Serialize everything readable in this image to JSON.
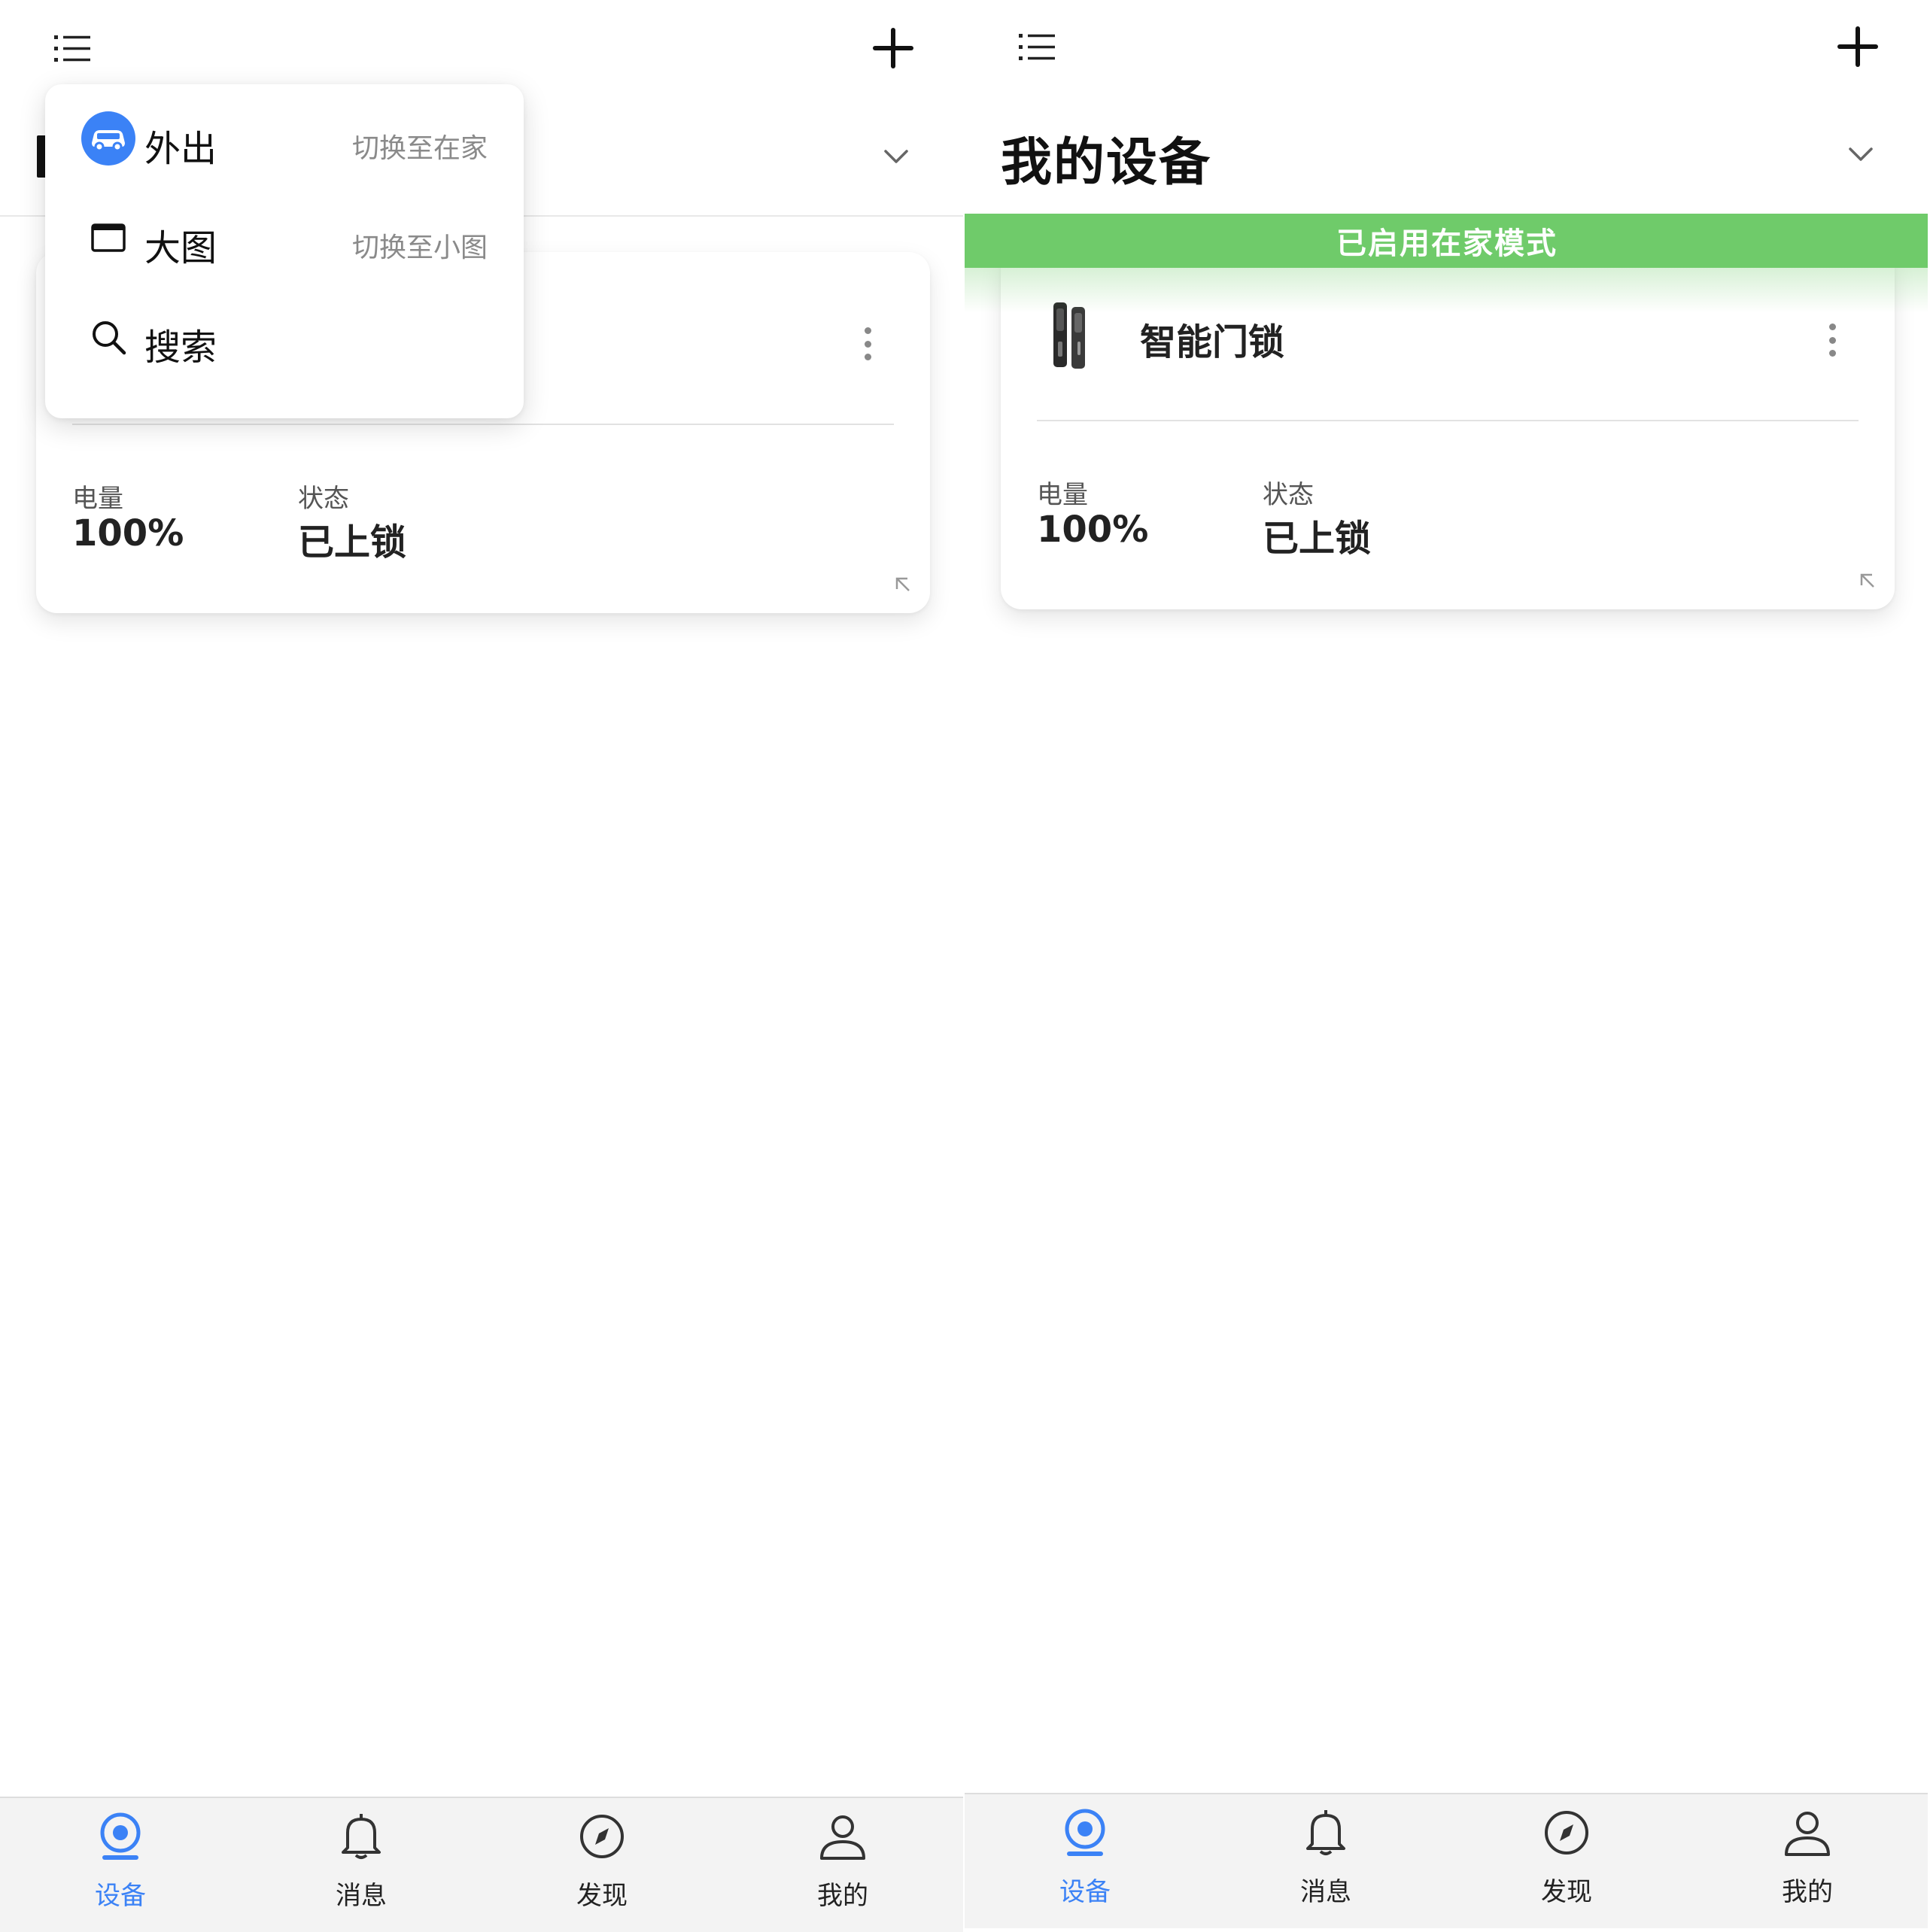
{
  "colors": {
    "accent": "#3b82f6",
    "banner": "#6fcb6a",
    "tabbar_bg": "#f3f3f3",
    "muted_text": "#8a8a8a"
  },
  "left": {
    "header": {
      "list_icon": "list-icon",
      "add_icon": "plus-icon",
      "chevron_icon": "chevron-down-icon"
    },
    "menu": [
      {
        "icon": "car-icon",
        "label": "外出",
        "sub": "切换至在家"
      },
      {
        "icon": "window-icon",
        "label": "大图",
        "sub": "切换至小图"
      },
      {
        "icon": "search-icon",
        "label": "搜索",
        "sub": ""
      }
    ],
    "card": {
      "battery_label": "电量",
      "battery_value": "100%",
      "status_label": "状态",
      "status_value": "已上锁"
    }
  },
  "right": {
    "header": {
      "title": "我的设备",
      "list_icon": "list-icon",
      "add_icon": "plus-icon",
      "chevron_icon": "chevron-down-icon"
    },
    "banner": "已启用在家模式",
    "card": {
      "device_name": "智能门锁",
      "battery_label": "电量",
      "battery_value": "100%",
      "status_label": "状态",
      "status_value": "已上锁"
    }
  },
  "tabs": [
    {
      "icon": "device-camera-icon",
      "label": "设备",
      "active": true
    },
    {
      "icon": "bell-icon",
      "label": "消息",
      "active": false
    },
    {
      "icon": "compass-icon",
      "label": "发现",
      "active": false
    },
    {
      "icon": "person-icon",
      "label": "我的",
      "active": false
    }
  ]
}
